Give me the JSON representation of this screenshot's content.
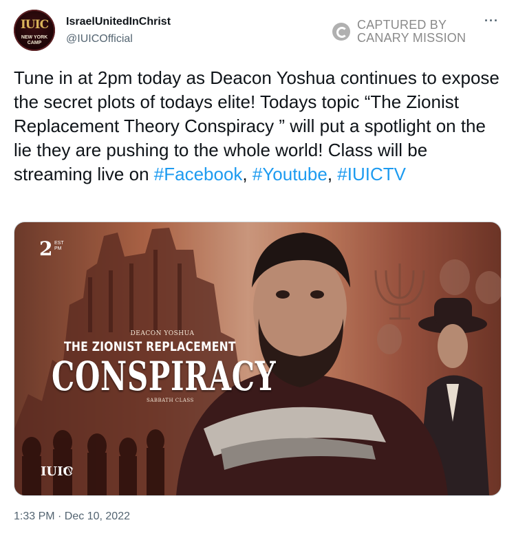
{
  "author": {
    "avatar_logo": "IUIC",
    "avatar_caption_line1": "NEW YORK",
    "avatar_caption_line2": "CAMP",
    "display_name": "IsraelUnitedInChrist",
    "handle": "@IUICOfficial"
  },
  "watermark": {
    "line1": "CAPTURED BY",
    "line2": "CANARY MISSION"
  },
  "menu_icon": "more-dots-icon",
  "tweet": {
    "text_part1": "Tune in at 2pm today as Deacon Yoshua continues to expose the secret plots of todays elite! Todays topic “The Zionist Replacement Theory Conspiracy ” will put a spotlight on the lie they are pushing to the whole world! Class will be streaming live on ",
    "hashtag1": "#Facebook",
    "sep1": ", ",
    "hashtag2": "#Youtube",
    "sep2": ", ",
    "hashtag3": "#IUICTV"
  },
  "poster": {
    "time": "2",
    "time_sup_line1": "EST",
    "time_sup_line2": "PM",
    "presenter": "DEACON YOSHUA",
    "title_line1": "THE ZIONIST REPLACEMENT",
    "title_line2": "CONSPIRACY",
    "subtitle": "SABBATH CLASS",
    "brand": "IUIC",
    "brand_suffix": "TV"
  },
  "timestamp": "1:33 PM · Dec 10, 2022",
  "colors": {
    "link": "#1d9bf0",
    "secondary_text": "#536471",
    "primary_text": "#0f1419"
  }
}
